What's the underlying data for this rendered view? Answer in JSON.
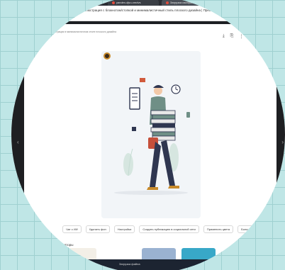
{
  "browser": {
    "tabs": [
      {
        "label": "yandex-djvu-xmdvs"
      },
      {
        "label": "Загрузка изображения"
      }
    ],
    "new_tab": "+",
    "address_title": "Минималистичная иллюстрация с блокнотом/стопкой и минималистичный стиль плоского дизайна | Превью-монитор",
    "address_sub": "ru/..."
  },
  "page": {
    "breadcrumb": "Иллюстрация в минималистичном стиле плоского дизайна",
    "tools": [
      "⤓",
      "⎘",
      "⋮"
    ],
    "nav_left": "‹",
    "nav_right": "›"
  },
  "actions": [
    {
      "label": "Чат с ИИ"
    },
    {
      "label": "Удалить фон"
    },
    {
      "label": "Настройки"
    },
    {
      "label": "Создать публикацию в социальной сети"
    },
    {
      "label": "Применить цвета"
    },
    {
      "label": "Больше возможностей с ИИ"
    }
  ],
  "authors_title": "Авторы",
  "taskbar": {
    "item": "Загрузка файла"
  },
  "colors": {
    "accent": "#3b2a1a",
    "thumb_colors": [
      "#f3efe7",
      "#ffffff",
      "#9ab2d1",
      "#38a8c8"
    ]
  }
}
